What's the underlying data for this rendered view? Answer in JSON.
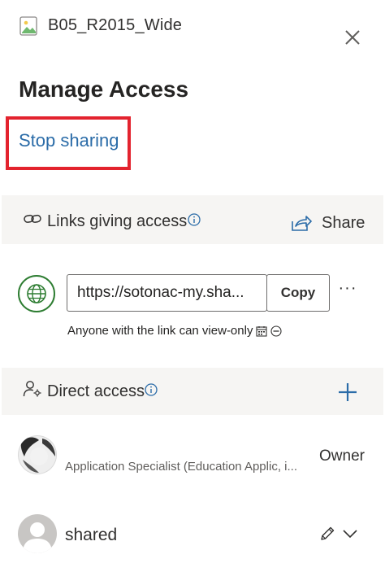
{
  "header": {
    "file_name": "B05_R2015_Wide",
    "file_icon": "image-file-icon",
    "close_icon": "close-icon"
  },
  "title": "Manage Access",
  "stop_sharing_label": "Stop sharing",
  "links_section": {
    "label": "Links giving access",
    "share_label": "Share",
    "link": {
      "url": "https://sotonac-my.sha...",
      "copy_label": "Copy",
      "more_label": "···",
      "description": "Anyone with the link can view-only"
    }
  },
  "direct_section": {
    "label": "Direct access",
    "people": [
      {
        "subtitle": "Application Specialist (Education Applic, i...",
        "role": "Owner"
      },
      {
        "name": "shared"
      }
    ]
  },
  "colors": {
    "accent": "#2b6ca8",
    "highlight": "#e3232e",
    "globe": "#2e7d32",
    "band": "#f6f5f3"
  }
}
